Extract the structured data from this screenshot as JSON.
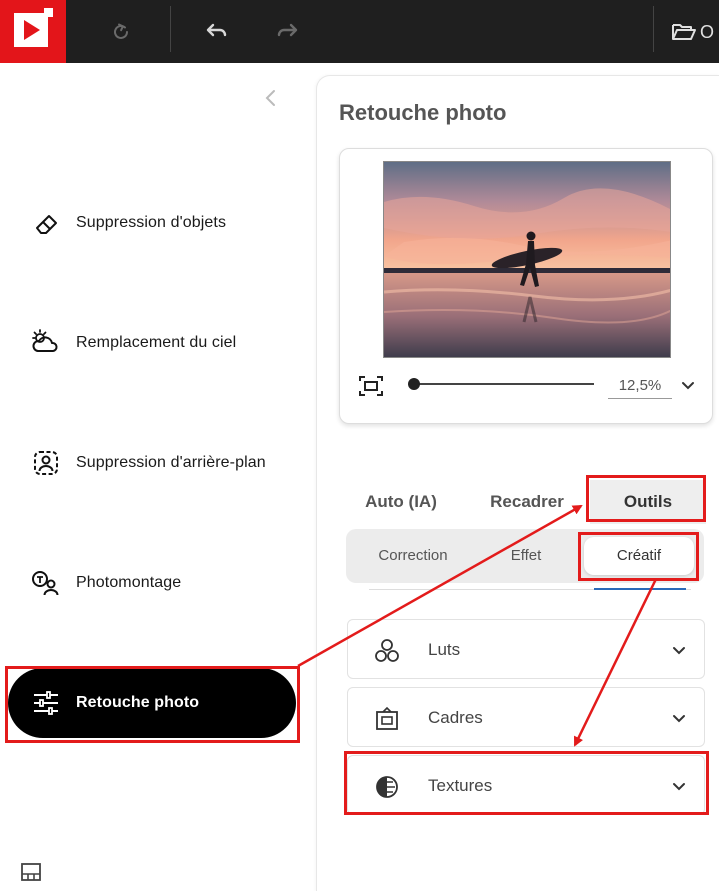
{
  "toolbar": {
    "logo_icon": "play-logo-icon",
    "history_icon": "refresh-icon",
    "undo_icon": "undo-icon",
    "redo_icon": "redo-icon",
    "open_icon": "folder-open-icon",
    "open_label_partial": "O"
  },
  "sidebar": {
    "collapse_icon": "chevron-left-icon",
    "items": [
      {
        "label": "Suppression d'objets",
        "icon": "eraser-icon"
      },
      {
        "label": "Remplacement du ciel",
        "icon": "cloud-sun-icon"
      },
      {
        "label": "Suppression d'arrière-plan",
        "icon": "person-frame-icon"
      },
      {
        "label": "Photomontage",
        "icon": "person-swap-icon"
      },
      {
        "label": "Retouche photo",
        "icon": "sliders-icon",
        "active": true
      }
    ],
    "bottom_icon": "layout-icon"
  },
  "panel": {
    "title": "Retouche photo",
    "preview": {
      "image": "surfer-at-sunset-beach",
      "fit_icon": "fit-screen-icon",
      "zoom_value": "12,5%",
      "zoom_level": 0.0,
      "zoom_dropdown_icon": "chevron-down-icon"
    },
    "tabs": [
      {
        "label": "Auto (IA)"
      },
      {
        "label": "Recadrer"
      },
      {
        "label": "Outils",
        "active": true
      }
    ],
    "subtabs": [
      {
        "label": "Correction"
      },
      {
        "label": "Effet"
      },
      {
        "label": "Créatif",
        "active": true
      }
    ],
    "sections": [
      {
        "label": "Luts",
        "icon": "circles-icon"
      },
      {
        "label": "Cadres",
        "icon": "frame-icon"
      },
      {
        "label": "Textures",
        "icon": "contrast-icon"
      }
    ]
  },
  "colors": {
    "brand_red": "#e3151a",
    "highlight_red": "#e31b1b",
    "topbar": "#1f1f1f",
    "active_nav": "#000000",
    "underline_blue": "#2a6ab8"
  }
}
